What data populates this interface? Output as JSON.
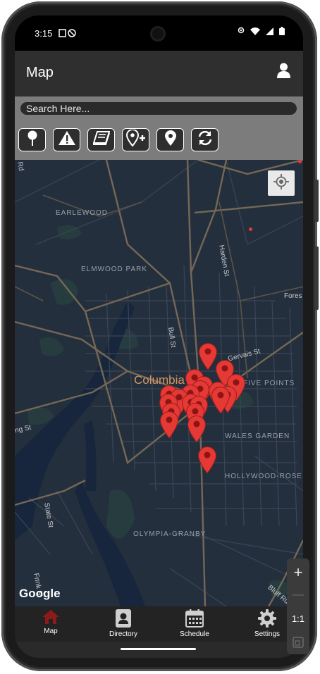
{
  "status": {
    "time": "3:15"
  },
  "appbar": {
    "title": "Map"
  },
  "search": {
    "placeholder": "Search Here..."
  },
  "toolbar": {
    "tools": [
      {
        "icon": "pushpin-icon"
      },
      {
        "icon": "warning-icon"
      },
      {
        "icon": "book-icon"
      },
      {
        "icon": "add-location-icon"
      },
      {
        "icon": "location-pin-icon"
      },
      {
        "icon": "refresh-icon"
      }
    ]
  },
  "map": {
    "city": "Columbia",
    "neighborhoods": [
      "EARLEWOOD",
      "ELMWOOD PARK",
      "FIVE POINTS",
      "WALES GARDEN",
      "HOLLYWOOD-ROSE",
      "OLYMPIA-GRANBY"
    ],
    "roads": [
      "Bull St",
      "Gervais St",
      "Harden St",
      "State St",
      "Frink St",
      "Bluff Rd",
      "ng St",
      "Fores",
      "Rd"
    ],
    "attribution": "Google",
    "marker_color": "#e53935"
  },
  "nav": {
    "items": [
      {
        "label": "Map",
        "icon": "map-icon",
        "active": true
      },
      {
        "label": "Directory",
        "icon": "contacts-icon"
      },
      {
        "label": "Schedule",
        "icon": "calendar-icon"
      },
      {
        "label": "Settings",
        "icon": "gear-icon"
      }
    ],
    "active_color": "#8b1a1a"
  },
  "zoom": {
    "plus": "+",
    "minus": "—",
    "ratio": "1:1"
  }
}
